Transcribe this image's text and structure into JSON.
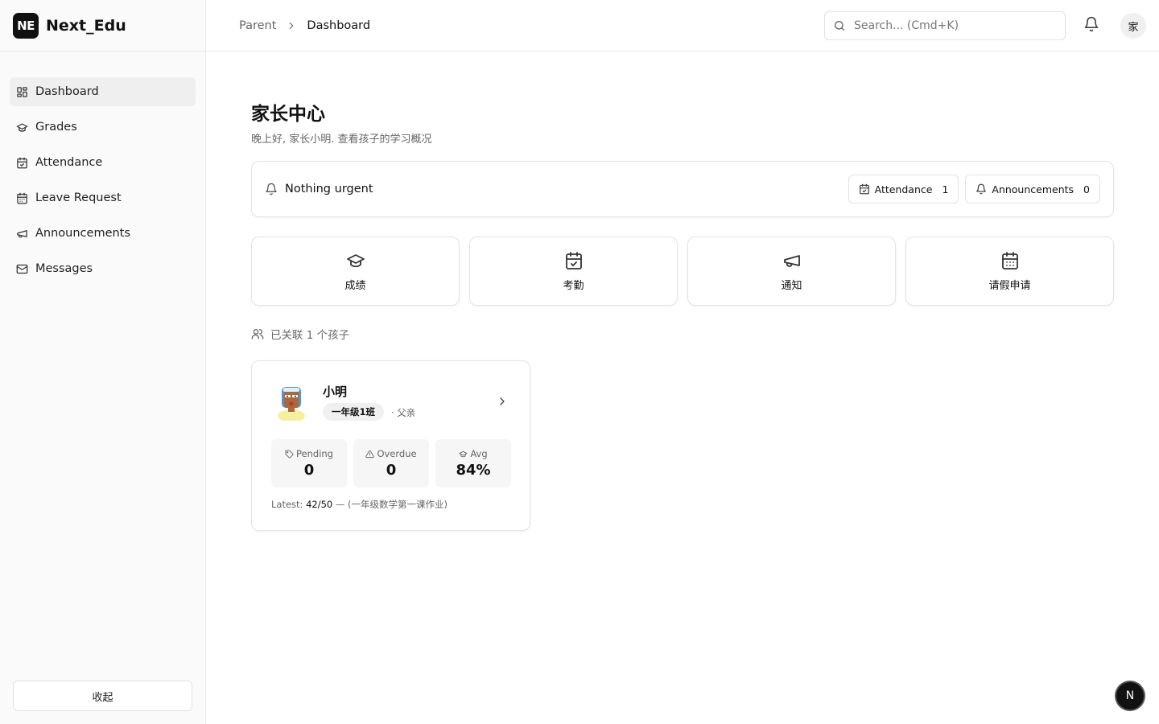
{
  "brand": {
    "logo": "NE",
    "name": "Next_Edu"
  },
  "sidebar": {
    "items": [
      {
        "label": "Dashboard",
        "icon": "dashboard-icon",
        "active": true
      },
      {
        "label": "Grades",
        "icon": "graduation-cap-icon"
      },
      {
        "label": "Attendance",
        "icon": "calendar-check-icon"
      },
      {
        "label": "Leave Request",
        "icon": "calendar-icon"
      },
      {
        "label": "Announcements",
        "icon": "megaphone-icon"
      },
      {
        "label": "Messages",
        "icon": "mail-icon"
      }
    ],
    "collapse_label": "收起"
  },
  "topbar": {
    "breadcrumb": [
      "Parent",
      "Dashboard"
    ],
    "search_placeholder": "Search... (Cmd+K)",
    "avatar_text": "家"
  },
  "main": {
    "title": "家长中心",
    "subtitle": "晚上好, 家长小明. 查看孩子的学习概况",
    "alert": {
      "text": "Nothing urgent",
      "badges": [
        {
          "label": "Attendance",
          "count": "1",
          "icon": "calendar-check-icon"
        },
        {
          "label": "Announcements",
          "count": "0",
          "icon": "bell-icon"
        }
      ]
    },
    "quick_links": [
      {
        "label": "成绩",
        "icon": "graduation-cap-icon"
      },
      {
        "label": "考勤",
        "icon": "calendar-check-icon"
      },
      {
        "label": "通知",
        "icon": "megaphone-icon"
      },
      {
        "label": "请假申请",
        "icon": "calendar-grid-icon"
      }
    ],
    "linked_children": "已关联 1 个孩子",
    "child": {
      "name": "小明",
      "class": "一年级1班",
      "relation": "· 父亲",
      "stats": [
        {
          "label": "Pending",
          "value": "0",
          "icon": "tag-icon"
        },
        {
          "label": "Overdue",
          "value": "0",
          "icon": "alert-triangle-icon"
        },
        {
          "label": "Avg",
          "value": "84%",
          "icon": "graduation-cap-icon"
        }
      ],
      "latest_label": "Latest:",
      "latest_score": "42/50",
      "latest_sep": "—",
      "latest_assignment": "(一年级数学第一课作业)"
    }
  },
  "fab_text": "N",
  "colors": {
    "accent": "#111111",
    "sidebar_bg": "#fafafa",
    "border": "#e4e4e4",
    "muted_text": "#666666"
  }
}
